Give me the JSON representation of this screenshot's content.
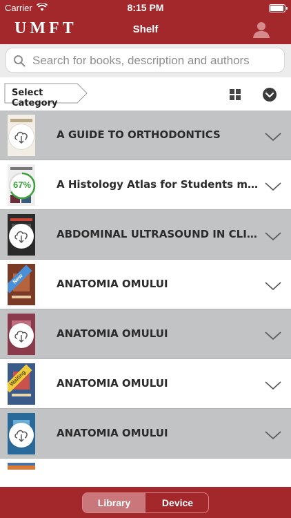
{
  "status_bar": {
    "carrier": "Carrier",
    "time": "8:15 PM"
  },
  "nav": {
    "logo": "UMFT",
    "title": "Shelf"
  },
  "search": {
    "placeholder": "Search for books, description and authors",
    "value": ""
  },
  "toolbar": {
    "category_label": "Select Category"
  },
  "books": [
    {
      "title": "A GUIDE TO ORTHODONTICS",
      "state": "download",
      "progress": null,
      "ribbon": null
    },
    {
      "title": "A Histology Atlas for Students made...",
      "state": "progress",
      "progress": "67%",
      "progress_value": 0.67,
      "ribbon": null
    },
    {
      "title": "ABDOMINAL ULTRASOUND IN CLINI...",
      "state": "download",
      "progress": null,
      "ribbon": null
    },
    {
      "title": "ANATOMIA OMULUI",
      "state": "ready",
      "progress": null,
      "ribbon": "New"
    },
    {
      "title": "ANATOMIA OMULUI",
      "state": "download",
      "progress": null,
      "ribbon": null
    },
    {
      "title": "ANATOMIA OMULUI",
      "state": "ready",
      "progress": null,
      "ribbon": "Waiting"
    },
    {
      "title": "ANATOMIA OMULUI",
      "state": "download",
      "progress": null,
      "ribbon": null
    }
  ],
  "tabs": {
    "library": "Library",
    "device": "Device",
    "active": "Library"
  },
  "colors": {
    "brand": "#a3282c",
    "row_gray": "#c2c3c5",
    "progress_green": "#3aa03a"
  }
}
